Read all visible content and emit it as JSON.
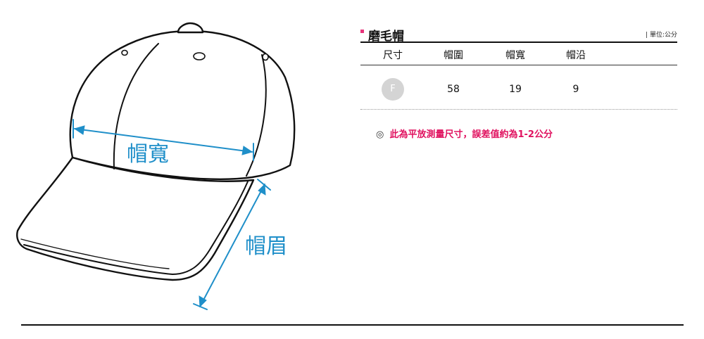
{
  "diagram": {
    "labels": {
      "width": "帽寬",
      "brim": "帽眉"
    }
  },
  "table": {
    "title": "磨毛帽",
    "unit": "| 單位:公分",
    "headers": [
      "尺寸",
      "帽圍",
      "帽寬",
      "帽沿"
    ],
    "rows": [
      {
        "size": "F",
        "values": [
          "58",
          "19",
          "9"
        ]
      }
    ]
  },
  "note": {
    "icon": "double-circle-icon",
    "symbol": "◎",
    "text": "此為平放測量尺寸，誤差值約為1-2公分"
  },
  "colors": {
    "accent_pink": "#e8357b",
    "note_text": "#e0115f",
    "dimension_blue": "#1f8fc9",
    "size_badge": "#d4d4d4"
  }
}
